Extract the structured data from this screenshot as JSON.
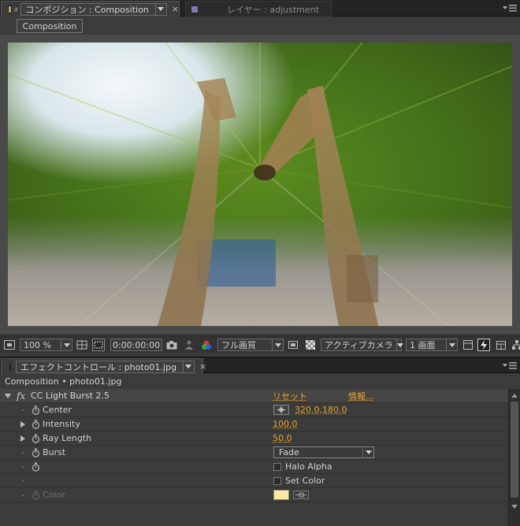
{
  "comp_panel": {
    "active_tab_label": "コンポジション : Composition",
    "inactive_tab_label": "レイヤー : adjustment",
    "composition_button": "Composition"
  },
  "viewer_toolbar": {
    "zoom": "100 %",
    "timecode": "0:00:00:00",
    "resolution": "フル画質",
    "camera": "アクティブカメラ",
    "views": "1 画面"
  },
  "effect_panel": {
    "tab_label": "エフェクトコントロール : photo01.jpg",
    "header": "Composition • photo01.jpg",
    "effect_name": "CC Light Burst 2.5",
    "reset_label": "リセット",
    "about_label": "情報...",
    "properties": {
      "center": {
        "name": "Center",
        "value": "320.0,180.0"
      },
      "intensity": {
        "name": "Intensity",
        "value": "100.0"
      },
      "ray_length": {
        "name": "Ray Length",
        "value": "50.0"
      },
      "burst": {
        "name": "Burst",
        "value": "Fade"
      },
      "halo_alpha": {
        "label": "Halo Alpha",
        "checked": false
      },
      "set_color": {
        "label": "Set Color",
        "checked": false
      },
      "color": {
        "name": "Color",
        "swatch": "#ffeb9e"
      }
    }
  },
  "colors": {
    "accent_value": "#e8a52a",
    "panel_bg": "#3b3b3b",
    "label_color": "#b6a56a"
  }
}
